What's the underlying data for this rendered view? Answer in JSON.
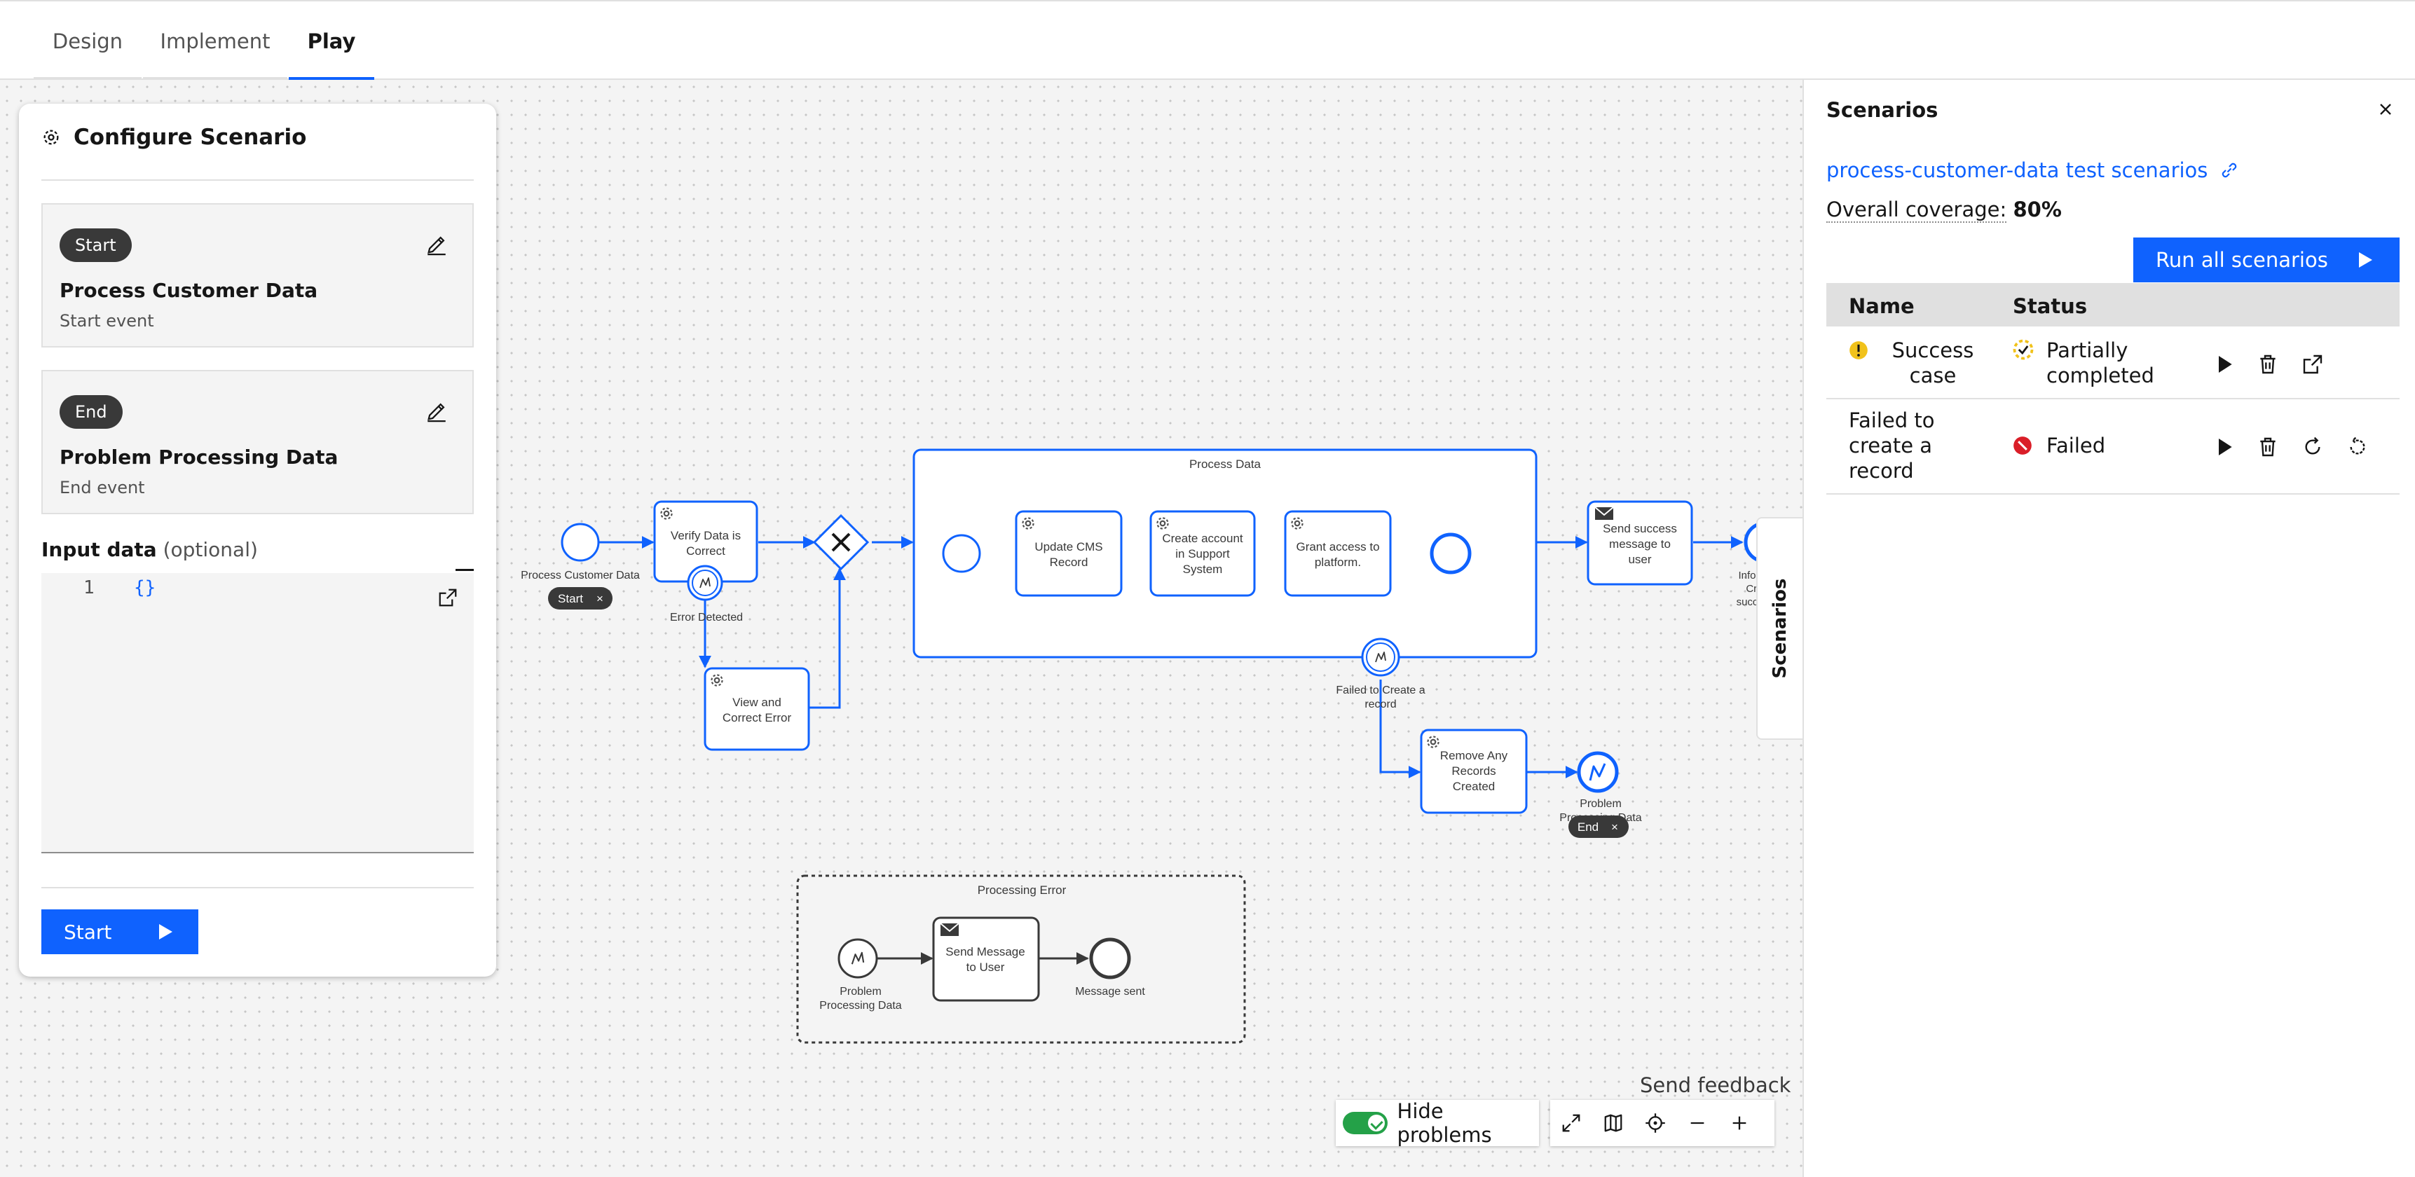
{
  "tabs": [
    {
      "label": "Design",
      "active": false
    },
    {
      "label": "Implement",
      "active": false
    },
    {
      "label": "Play",
      "active": true
    }
  ],
  "config": {
    "title": "Configure Scenario",
    "start_card": {
      "pill": "Start",
      "name": "Process Customer Data",
      "type": "Start event"
    },
    "end_card": {
      "pill": "End",
      "name": "Problem Processing Data",
      "type": "End event"
    },
    "input_label": "Input data",
    "input_optional": "(optional)",
    "editor_line": "1",
    "editor_code": "{}",
    "start_button": "Start"
  },
  "diagram": {
    "start_event_label": "Process Customer Data",
    "start_badge": "Start",
    "verify_task": "Verify Data is Correct",
    "error_detected": "Error Detected",
    "view_correct": "View and Correct Error",
    "subprocess_title": "Process Data",
    "update_cms": "Update CMS Record",
    "create_account": "Create account in Support System",
    "grant_access": "Grant access to platform.",
    "send_success": "Send success message to user",
    "info_created": "Information Created successfully",
    "failed_create": "Failed to Create a record",
    "remove_records": "Remove Any Records Created",
    "problem_end": "Problem Processing Data",
    "end_badge": "End",
    "error_subprocess_title": "Processing Error",
    "problem_start": "Problem Processing Data",
    "send_message": "Send Message to User",
    "message_sent": "Message sent",
    "accent": "#0f62fe"
  },
  "toolbar": {
    "hide_problems": "Hide problems",
    "send_feedback": "Send feedback",
    "buttons": [
      "expand-icon",
      "map-icon",
      "crosshair-icon",
      "zoom-out-icon",
      "zoom-in-icon"
    ]
  },
  "side_tab": "Scenarios",
  "scenarios": {
    "title": "Scenarios",
    "link": "process-customer-data test scenarios",
    "coverage_label": "Overall coverage:",
    "coverage_value": "80%",
    "run_all": "Run all scenarios",
    "col_name": "Name",
    "col_status": "Status",
    "rows": [
      {
        "name": "Success case",
        "status": "Partially completed",
        "status_color": "#f1c21b"
      },
      {
        "name": "Failed to create a record",
        "status": "Failed",
        "status_color": "#da1e28"
      }
    ]
  }
}
